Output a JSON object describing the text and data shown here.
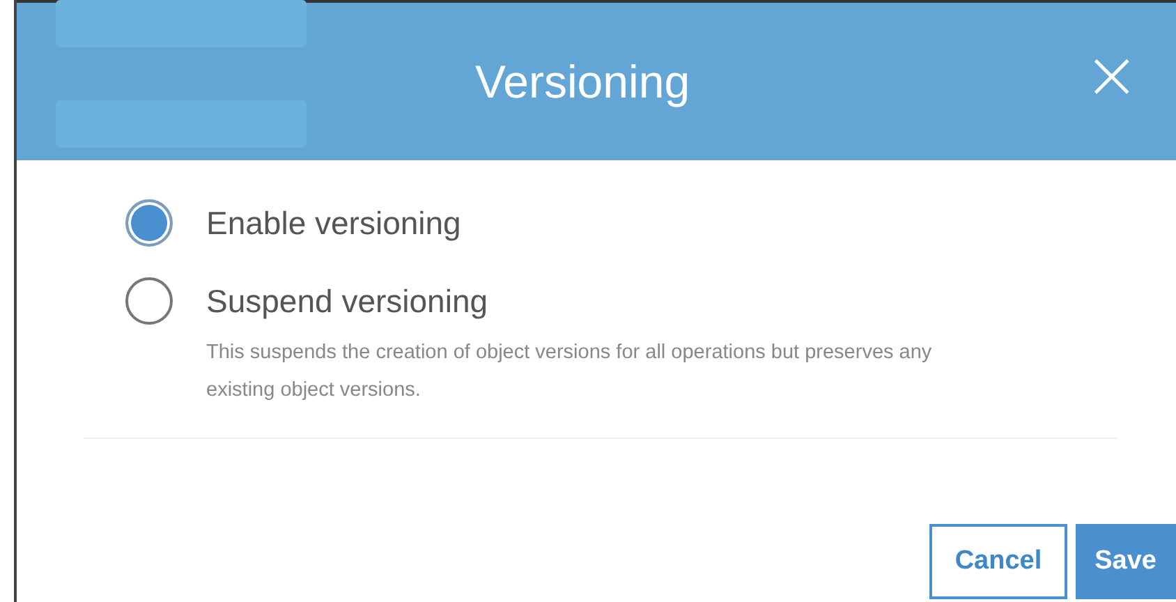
{
  "dialog": {
    "title": "Versioning",
    "close": "×"
  },
  "options": [
    {
      "label": "Enable versioning",
      "selected": true
    },
    {
      "label": "Suspend versioning",
      "selected": false,
      "description": "This suspends the creation of object versions for all operations but preserves any existing object versions."
    }
  ],
  "buttons": [
    {
      "label": "Cancel",
      "kind": "secondary"
    },
    {
      "label": "Save",
      "kind": "primary"
    }
  ]
}
